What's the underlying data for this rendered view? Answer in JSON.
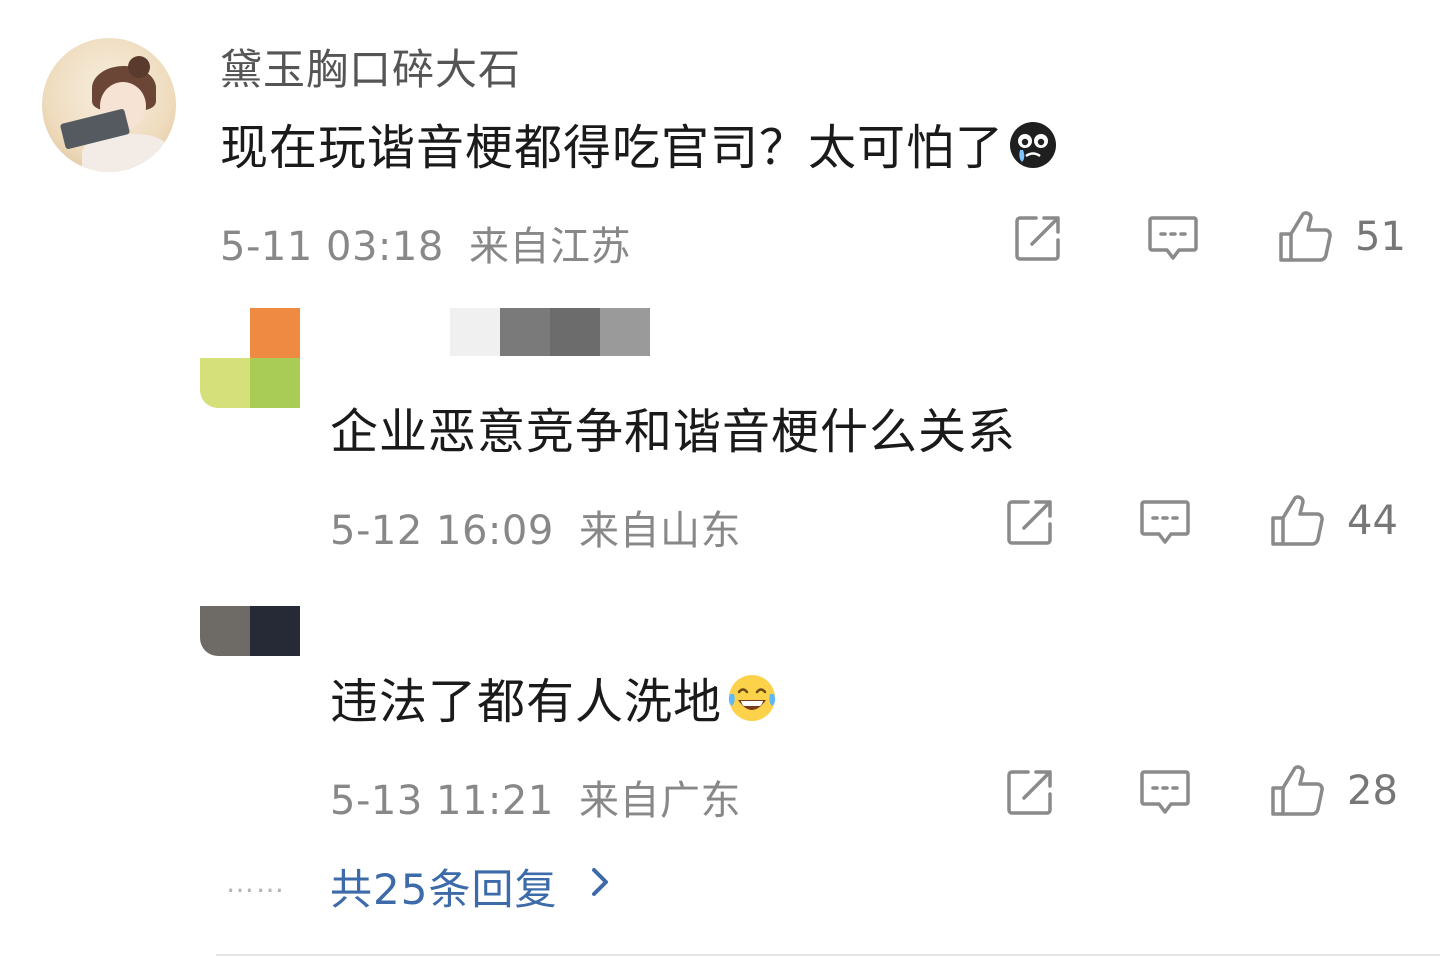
{
  "comment": {
    "username": "黛玉胸口碎大石",
    "text": "现在玩谐音梗都得吃官司？太可怕了",
    "emoji": "crying-face-emoji",
    "time": "5-11 03:18",
    "location": "来自江苏",
    "likes": "51"
  },
  "replies": [
    {
      "text": "企业恶意竞争和谐音梗什么关系",
      "time": "5-12 16:09",
      "location": "来自山东",
      "likes": "44"
    },
    {
      "text": "违法了都有人洗地",
      "emoji": "laughing-tears-emoji",
      "time": "5-13 11:21",
      "location": "来自广东",
      "likes": "28"
    }
  ],
  "more": {
    "dots": "……",
    "label": "共25条回复"
  },
  "icons": {
    "share": "share-icon",
    "comment": "comment-icon",
    "like": "thumbs-up-icon",
    "chevron": "chevron-right-icon"
  },
  "colors": {
    "link": "#3d6aa8",
    "meta": "#888888",
    "icon": "#8a8a8a"
  }
}
